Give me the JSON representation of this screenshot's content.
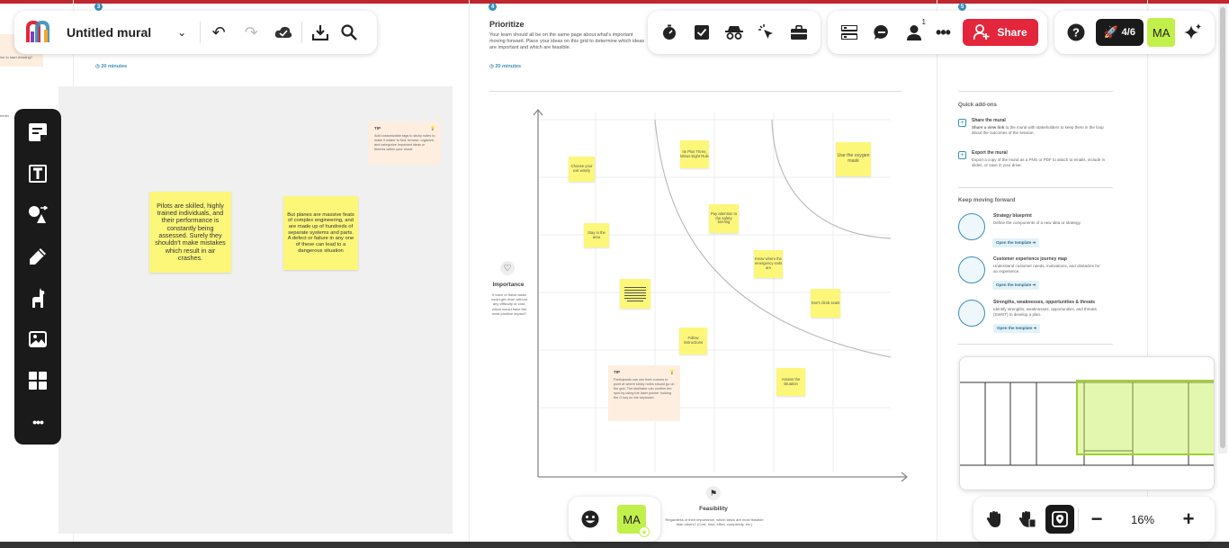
{
  "window": {
    "title": "Untitled mural"
  },
  "toolbar_top_left": {
    "board_title": "Untitled mural"
  },
  "collaboration": {
    "share_label": "Share",
    "notifications_count": "1",
    "onboarding_progress": "4/6",
    "user_initials": "MA"
  },
  "canvas_left": {
    "step_number": "3",
    "duration": "20 minutes",
    "tip_label": "TIP",
    "tip_text": "Add customizable tags to sticky notes to make it easier to find, browse, organize, and categorize important ideas or themes within your mural.",
    "left_clip_text": "ine to start drawing?",
    "left_clip_text2": "eedin",
    "sticky_1": "Pilots are skilled, highly trained individuals, and their performance is constantly being assessed. Surely they shouldn't make mistakes which result in air crashes.",
    "sticky_2": "But planes are massive feats of complex engineering, and are made up of hundreds of separate systems and parts. A defect or failure in any one of these can lead to a dangerous situation"
  },
  "prioritize": {
    "step_number": "4",
    "title": "Prioritize",
    "description": "Your team should all be on the same page about what's important moving forward. Place your ideas on this grid to determine which ideas are important and which are feasible.",
    "duration": "20 minutes",
    "y_axis_label": "Importance",
    "y_axis_desc": "If each of these tasks could get done without any difficulty or cost, which would have the most positive impact?",
    "x_axis_label": "Feasibility",
    "x_axis_desc": "Regardless of their importance, which tasks are most feasible than others? (Cost, time, effort, complexity, etc.)",
    "tip_label": "TIP",
    "tip_text": "Participants can use their cursors to point at where sticky notes should go on the grid. The facilitator can confirm the spot by using the laser pointer holding the O key on the keyboard.",
    "stickies": {
      "s1": "Choose your exit wisely",
      "s2": "Ite Plus Three, Minus Eight Rule",
      "s3": "Use the oxygen mask",
      "s4": "Stay in the area",
      "s5": "Pay attention to the safety briefing",
      "s6": "Know where the emergency exits are",
      "s7": "Don't climb seats",
      "s8": "Follow instructions",
      "s9": "Assess the situation"
    }
  },
  "right_panel": {
    "step_number": "5",
    "quick_addons_title": "Quick add-ons",
    "share_title": "Share the mural",
    "share_desc_bold": "Share a view link",
    "share_desc": "to the mural with stakeholders to keep them in the loop about the outcomes of the session.",
    "export_title": "Export the mural",
    "export_desc": "Export a copy of the mural as a PNG or PDF to attach to emails, include in slides, or save in your drive.",
    "keep_moving_title": "Keep moving forward",
    "templates": [
      {
        "title": "Strategy blueprint",
        "desc": "Define the components of a new idea or strategy.",
        "button": "Open the template"
      },
      {
        "title": "Customer experience journey map",
        "desc": "Understand customer needs, motivations, and obstacles for an experience.",
        "button": "Open the template"
      },
      {
        "title": "Strengths, weaknesses, opportunities & threats",
        "desc": "Identify strengths, weaknesses, opportunities, and threats (SWOT) to develop a plan.",
        "button": "Open the template"
      }
    ]
  },
  "zoom": {
    "level": "16%"
  },
  "bottom_bar": {
    "user_initials": "MA"
  },
  "icons": [
    "mural-logo-icon",
    "chevron-down-icon",
    "undo-icon",
    "redo-icon",
    "cloud-saved-icon",
    "download-icon",
    "search-icon",
    "timer-icon",
    "checkbox-icon",
    "private-mode-icon",
    "laser-pointer-icon",
    "toolbox-icon",
    "outline-icon",
    "comment-icon",
    "user-icon",
    "more-icon",
    "share-user-icon",
    "help-icon",
    "rocket-icon",
    "sparkle-icon",
    "sticky-note-icon",
    "text-icon",
    "shapes-icon",
    "pen-icon",
    "llama-icon",
    "image-icon",
    "templates-icon",
    "hand-icon",
    "pan-mode-icon",
    "map-icon",
    "minus-icon",
    "plus-icon",
    "emoji-icon"
  ],
  "colors": {
    "brand_red": "#e3263b",
    "sticky_yellow": "#fcf779",
    "avatar_green": "#c2f04b",
    "sidebar_dark": "#1a1a1a",
    "accent_blue": "#3a8fb7"
  }
}
